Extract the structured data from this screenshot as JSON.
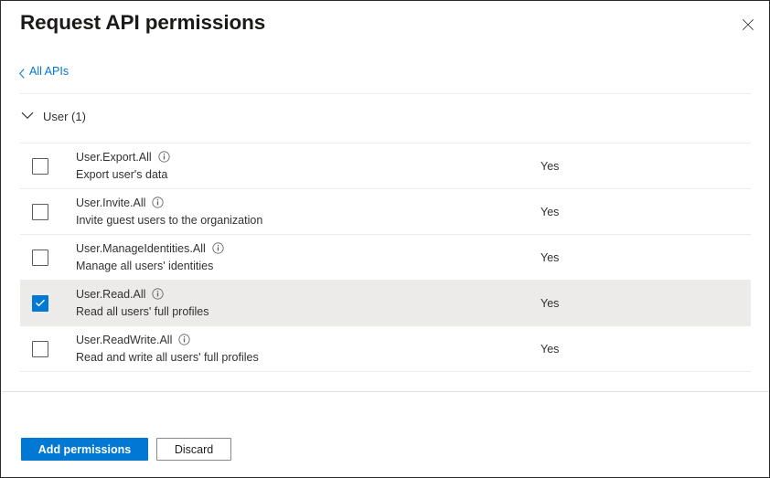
{
  "dialog": {
    "title": "Request API permissions",
    "close_icon": "close-icon"
  },
  "breadcrumb": {
    "back_icon": "chevron-left-icon",
    "label": "All APIs"
  },
  "group": {
    "expand_icon": "chevron-down-icon",
    "label": "User (1)"
  },
  "permissions": [
    {
      "name": "User.Export.All",
      "description": "Export user's data",
      "admin_consent": "Yes",
      "checked": false,
      "selected": false,
      "info_icon": "info-icon"
    },
    {
      "name": "User.Invite.All",
      "description": "Invite guest users to the organization",
      "admin_consent": "Yes",
      "checked": false,
      "selected": false,
      "info_icon": "info-icon"
    },
    {
      "name": "User.ManageIdentities.All",
      "description": "Manage all users' identities",
      "admin_consent": "Yes",
      "checked": false,
      "selected": false,
      "info_icon": "info-icon"
    },
    {
      "name": "User.Read.All",
      "description": "Read all users' full profiles",
      "admin_consent": "Yes",
      "checked": true,
      "selected": true,
      "info_icon": "info-icon"
    },
    {
      "name": "User.ReadWrite.All",
      "description": "Read and write all users' full profiles",
      "admin_consent": "Yes",
      "checked": false,
      "selected": false,
      "info_icon": "info-icon"
    }
  ],
  "footer": {
    "primary_label": "Add permissions",
    "secondary_label": "Discard"
  },
  "colors": {
    "accent": "#0078d4",
    "link": "#0078d4",
    "text": "#323130",
    "title_text": "#1b1a19",
    "row_selected_bg": "#edebe9",
    "divider": "#edebe9",
    "checkbox_border": "#605e5c"
  }
}
